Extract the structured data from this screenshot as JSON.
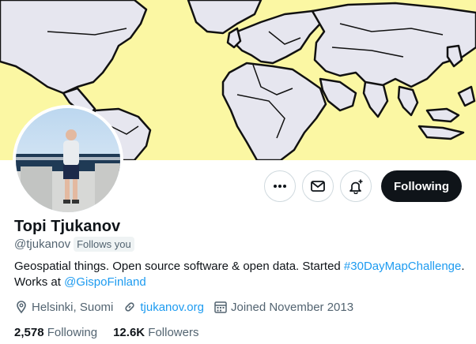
{
  "profile": {
    "name": "Topi Tjukanov",
    "handle": "@tjukanov",
    "follows_you": "Follows you",
    "bio_prefix": "Geospatial things. Open source software & open data. Started ",
    "bio_hashtag": "#30DayMapChallenge",
    "bio_middle": ". Works at ",
    "bio_mention": "@GispoFinland",
    "location": "Helsinki, Suomi",
    "website": "tjukanov.org",
    "joined": "Joined November 2013",
    "following_count": "2,578",
    "following_label": "Following",
    "followers_count": "12.6K",
    "followers_label": "Followers"
  },
  "actions": {
    "more_icon": "more-icon",
    "message_icon": "envelope-icon",
    "notify_icon": "bell-plus-icon",
    "follow_label": "Following"
  },
  "colors": {
    "banner_bg": "#fbf7a3",
    "link": "#1d9bf0",
    "text_secondary": "#536471",
    "follow_button_bg": "#0f1419"
  }
}
